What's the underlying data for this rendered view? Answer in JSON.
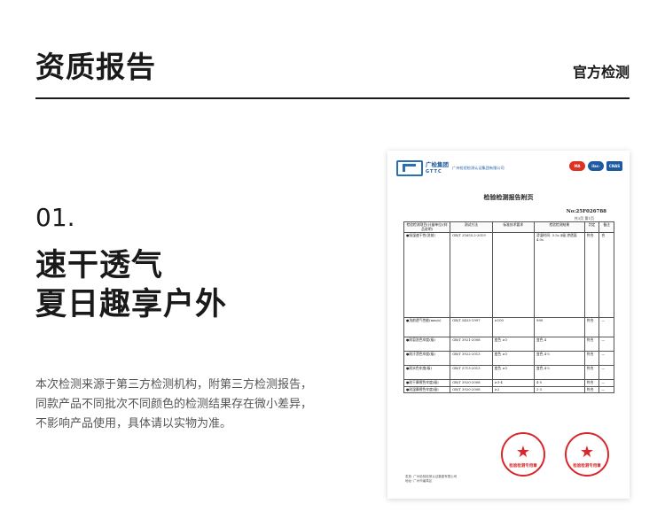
{
  "header": {
    "title": "资质报告",
    "badge": "官方检测"
  },
  "section": {
    "number": "01.",
    "headline_1": "速干透气",
    "headline_2": "夏日趣享户外",
    "description": [
      "本次检测来源于第三方检测机构，附第三方检测报告，",
      "同款产品不同批次不同颜色的检测结果存在微小差异，",
      "不影响产品使用，具体请以实物为准。"
    ]
  },
  "document": {
    "logo_cn": "广检集团",
    "logo_en": "GTTC",
    "org_name": "广州检验检测认证集团有限公司",
    "certs": [
      "MA",
      "ilac-MRA",
      "CNAS"
    ],
    "title": "检验检测报告附页",
    "report_no": "No:25F026788",
    "page": "共3页 第1页",
    "table_headers": [
      "检验检测项目(计量单位)(样品说明)",
      "测试方法",
      "标准技术要求",
      "检验检测结果",
      "判定",
      "备注"
    ],
    "rows": [
      [
        "●吸湿速干性(洗前)",
        "GB/T 21655.2-2019",
        "",
        "浸湿时间: 3.5s 4级 渗透面 4.0s",
        "符合",
        "合"
      ],
      [
        "●洗前透气性能(mm/s)",
        "GB/T 5453-1997",
        "≥100",
        "980",
        "符合",
        "—"
      ],
      [
        "●耐皂洗色牢度(级)",
        "GB/T 3921-2008",
        "变色 ≥3",
        "变色 4",
        "符合",
        "—"
      ],
      [
        "●耐汗渍色牢度(级)",
        "GB/T 3922-2013",
        "变色 ≥3",
        "变色 4-5",
        "符合",
        "—"
      ],
      [
        "●耐水色牢度(级)",
        "GB/T 5713-2013",
        "变色 ≥3",
        "变色 4-5",
        "符合",
        "—"
      ],
      [
        "●耐干摩擦色牢度(级)",
        "GB/T 3920-2008",
        "≥3-4",
        "4-5",
        "符合",
        "—"
      ],
      [
        "●耐湿摩擦色牢度(级)",
        "GB/T 3920-2008",
        "≥2",
        "2-3",
        "符合",
        "—"
      ]
    ],
    "stamp_1": "检验检测专用章",
    "stamp_2": "检验检测专用章",
    "footer": [
      "发放: 广州检验检测认证集团有限公司",
      "地址: 广州市番禺区"
    ]
  }
}
